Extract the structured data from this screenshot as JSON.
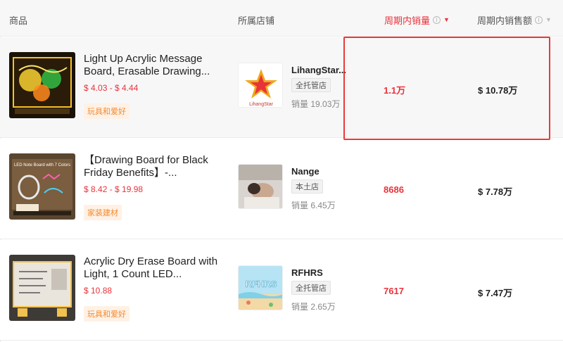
{
  "header": {
    "product": "商品",
    "store": "所属店铺",
    "sales": "周期内销量",
    "revenue": "周期内销售额"
  },
  "rows": [
    {
      "title": "Light Up Acrylic Message Board, Erasable Drawing...",
      "price": "$ 4.03 - $ 4.44",
      "category": "玩具和爱好",
      "store": {
        "name": "LihangStar...",
        "logo_text": "LihangStar",
        "tag": "全托管店",
        "volume": "销量 19.03万"
      },
      "sales": "1.1万",
      "revenue": "$ 10.78万"
    },
    {
      "title": "【Drawing Board for Black Friday Benefits】-...",
      "price": "$ 8.42 - $ 19.98",
      "category": "家装建材",
      "thumb_text": "LED Note Board with 7 Colors",
      "store": {
        "name": "Nange",
        "tag": "本土店",
        "volume": "销量 6.45万"
      },
      "sales": "8686",
      "revenue": "$ 7.78万"
    },
    {
      "title": "Acrylic Dry Erase Board with Light, 1 Count LED...",
      "price": "$ 10.88",
      "category": "玩具和爱好",
      "store": {
        "name": "RFHRS",
        "logo_text": "RFHRS",
        "tag": "全托管店",
        "volume": "销量 2.65万"
      },
      "sales": "7617",
      "revenue": "$ 7.47万"
    }
  ],
  "icons": {
    "info": "info-circle-icon",
    "sort_active": "sort-down-icon",
    "sort_inactive": "sort-down-icon"
  },
  "colors": {
    "accent_red": "#e8333a",
    "category_orange": "#f28a2e",
    "highlight_border": "#e83a3a"
  }
}
